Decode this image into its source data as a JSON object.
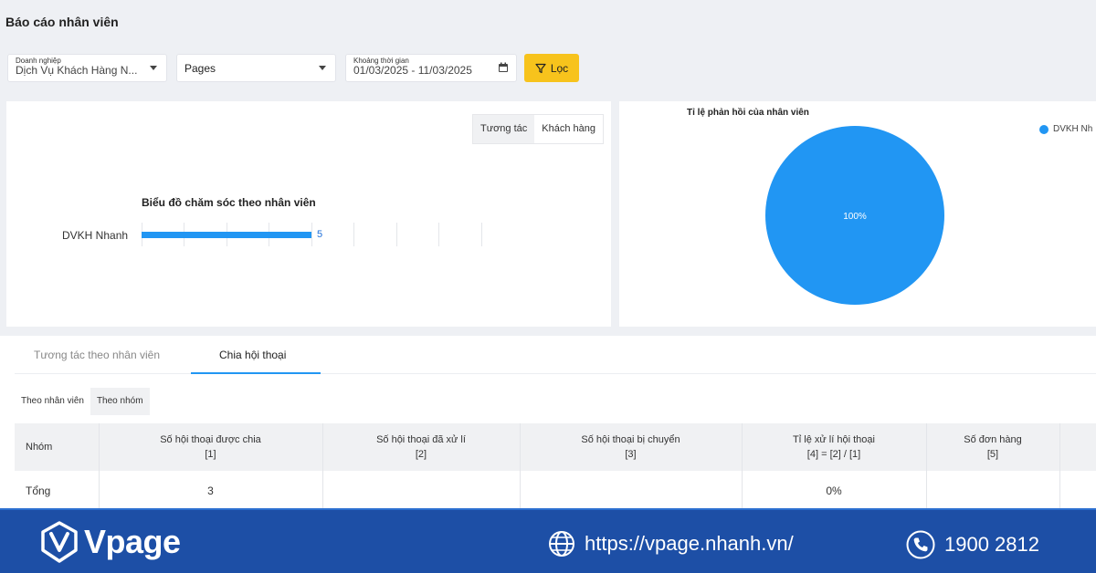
{
  "page_title": "Báo cáo nhân viên",
  "filters": {
    "business": {
      "label": "Doanh nghiệp",
      "value": "Dịch Vụ Khách Hàng N..."
    },
    "channel": {
      "value": "Pages"
    },
    "period": {
      "label": "Khoảng thời gian",
      "value": "01/03/2025 - 11/03/2025"
    },
    "filter_button": "Lọc"
  },
  "bar_panel": {
    "toggle": [
      "Tương tác",
      "Khách hàng"
    ],
    "active_toggle": 0
  },
  "pie_panel": {
    "legend": "DVKH Nh"
  },
  "tabs": [
    "Tương tác theo nhân viên",
    "Chia hội thoại"
  ],
  "active_tab": 1,
  "sub_toggle": [
    "Theo nhân viên",
    "Theo nhóm"
  ],
  "active_sub_toggle": 1,
  "table": {
    "headers": [
      {
        "line1": "Nhóm",
        "line2": ""
      },
      {
        "line1": "Số hội thoại được chia",
        "line2": "[1]"
      },
      {
        "line1": "Số hội thoại đã xử lí",
        "line2": "[2]"
      },
      {
        "line1": "Số hội thoại bị chuyển",
        "line2": "[3]"
      },
      {
        "line1": "Tỉ lệ xử lí hội thoại",
        "line2": "[4] = [2] / [1]"
      },
      {
        "line1": "Số đơn hàng",
        "line2": "[5]"
      }
    ],
    "rows": [
      [
        "Tổng",
        "3",
        "",
        "",
        "0%",
        ""
      ]
    ]
  },
  "footer": {
    "brand": "Vpage",
    "website": "https://vpage.nhanh.vn/",
    "phone": "1900 2812"
  },
  "colors": {
    "accent": "#2196f3",
    "filter_button": "#f7c31c",
    "footer": "#1d4fa6"
  },
  "chart_data": [
    {
      "type": "bar",
      "orientation": "horizontal",
      "title": "Biểu đồ chăm sóc theo nhân viên",
      "categories": [
        "DVKH Nhanh"
      ],
      "values": [
        5
      ],
      "xlim": [
        0,
        10
      ],
      "grid": true
    },
    {
      "type": "pie",
      "title": "Tỉ lệ phản hồi của nhân viên",
      "categories": [
        "DVKH Nh"
      ],
      "values": [
        100
      ],
      "labels": [
        "100%"
      ],
      "legend": "top-right"
    }
  ]
}
